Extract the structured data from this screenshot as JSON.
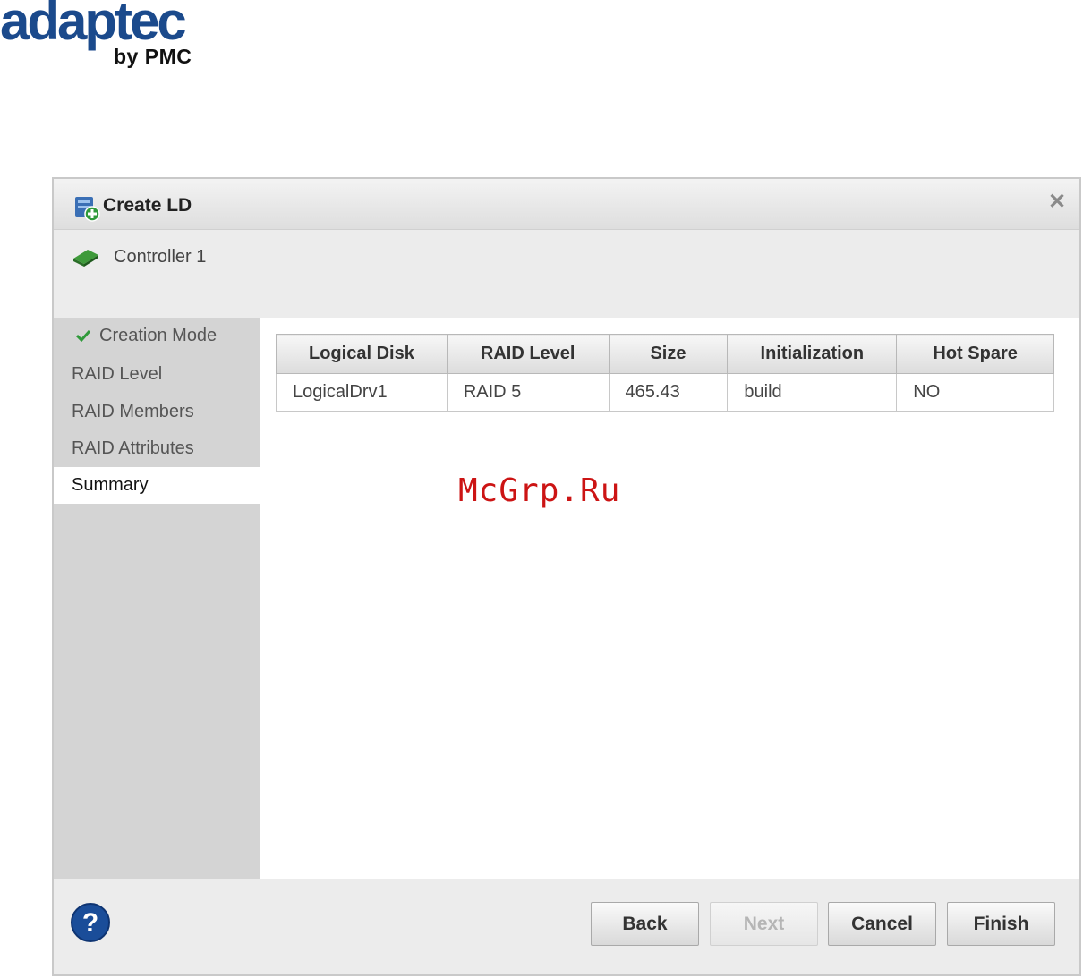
{
  "logo": {
    "main": "adaptec",
    "sub": "by PMC"
  },
  "dialog": {
    "title": "Create LD",
    "title_icon": "create-logical-drive-icon",
    "close_icon": "close-icon",
    "controller": {
      "label": "Controller 1",
      "icon": "controller-card-icon"
    }
  },
  "sidebar": {
    "items": [
      {
        "label": "Creation Mode",
        "completed": true
      },
      {
        "label": "RAID Level"
      },
      {
        "label": "RAID Members"
      },
      {
        "label": "RAID Attributes"
      },
      {
        "label": "Summary",
        "active": true
      }
    ]
  },
  "summary_table": {
    "headers": [
      "Logical Disk",
      "RAID Level",
      "Size",
      "Initialization",
      "Hot Spare"
    ],
    "rows": [
      [
        "LogicalDrv1",
        "RAID 5",
        "465.43",
        "build",
        "NO"
      ]
    ]
  },
  "watermark": "McGrp.Ru",
  "footer": {
    "help_icon": "help-icon",
    "back": "Back",
    "next": "Next",
    "cancel": "Cancel",
    "finish": "Finish"
  },
  "colors": {
    "logo_blue": "#1b4a8c",
    "check_green": "#2f9a3a",
    "watermark_red": "#cc1414",
    "help_blue": "#1a4d99"
  }
}
